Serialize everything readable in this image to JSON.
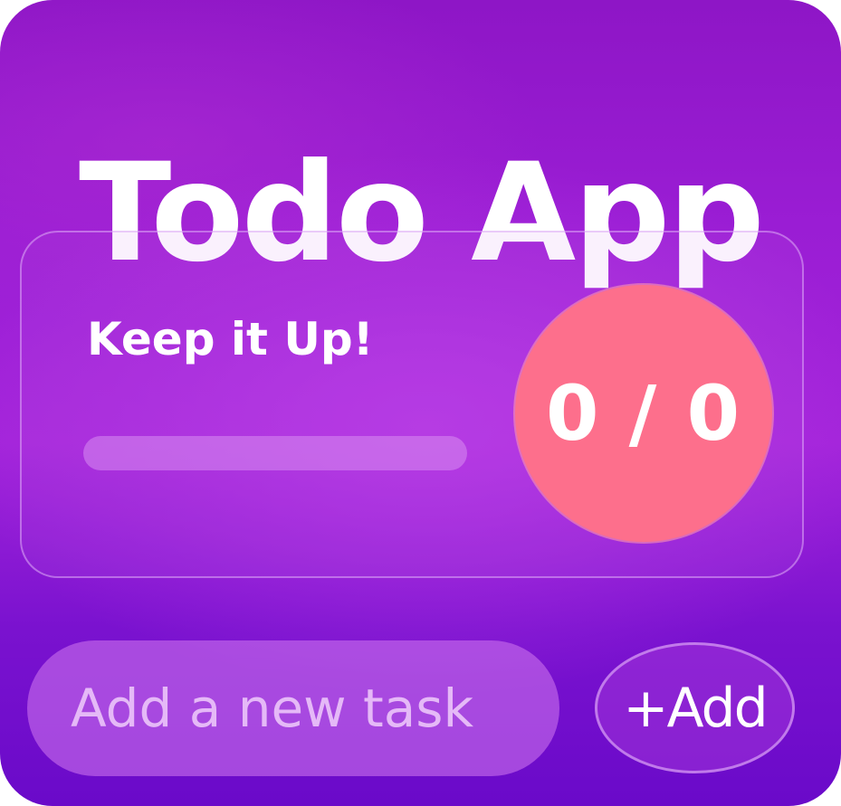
{
  "app": {
    "title": "Todo App"
  },
  "progress_card": {
    "heading": "Keep it Up!",
    "progress_fraction": 0,
    "counter_text": "0 / 0"
  },
  "task_form": {
    "input_placeholder": "Add a new task",
    "input_value": "",
    "add_label": "+Add"
  },
  "colors": {
    "background_top": "#8e16c6",
    "background_bottom": "#6a0ac9",
    "counter_circle": "#fd6f8c",
    "text": "#ffffff"
  }
}
